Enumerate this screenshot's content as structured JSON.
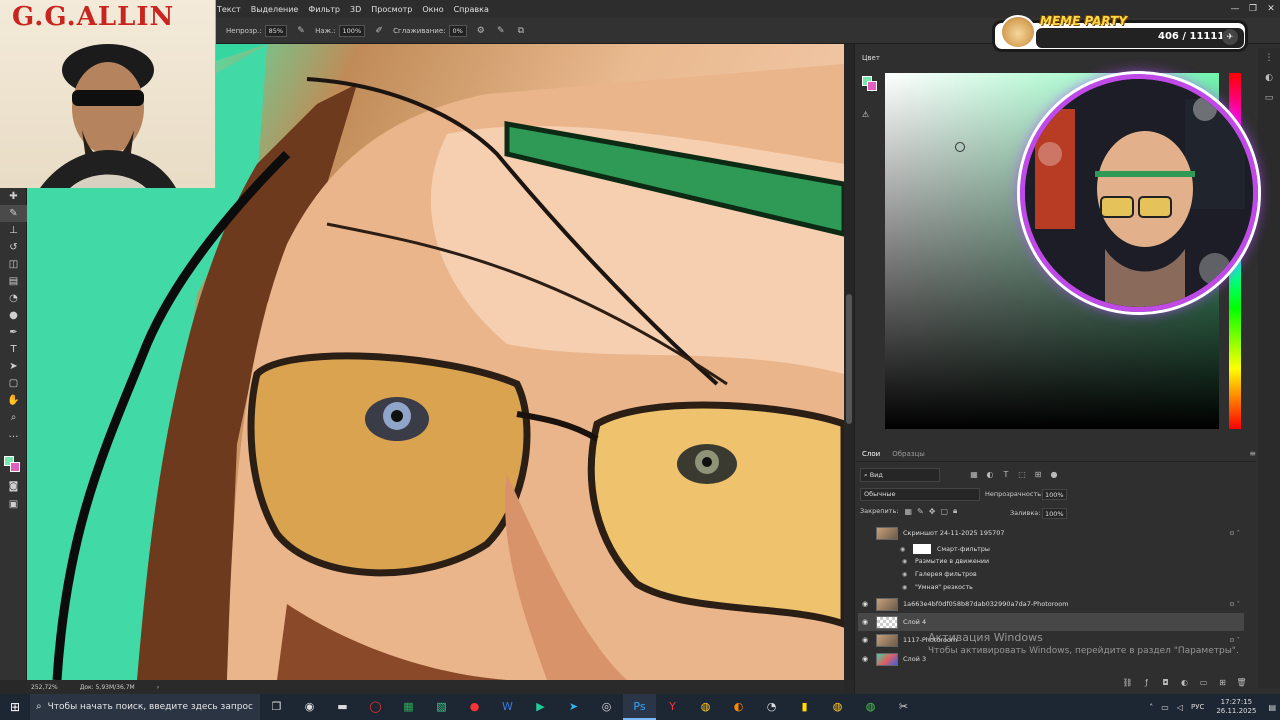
{
  "menu": {
    "items": [
      "Текст",
      "Выделение",
      "Фильтр",
      "3D",
      "Просмотр",
      "Окно",
      "Справка"
    ],
    "window_controls": [
      "—",
      "❐",
      "✕"
    ]
  },
  "options": {
    "opacity_label": "Непрозр.:",
    "opacity_value": "85%",
    "pressure_label": "Наж.:",
    "pressure_value": "100%",
    "smoothing_label": "Сглаживание:",
    "smoothing_value": "0%"
  },
  "overlay_photo": {
    "title": "G.G.ALLIN"
  },
  "status": {
    "zoom": "252,72%",
    "doc": "Док: 5,93M/36,7M",
    "arrow": "›"
  },
  "color_panel": {
    "title": "Цвет"
  },
  "layers_panel": {
    "tabs": [
      "Слои",
      "Образцы"
    ],
    "filter_label": "Вид",
    "blend_mode": "Обычные",
    "opacity_label": "Непрозрачность:",
    "opacity_value": "100%",
    "lock_label": "Закрепить:",
    "fill_label": "Заливка:",
    "fill_value": "100%",
    "layers": [
      {
        "name": "Скриншот 24-11-2025 195707"
      },
      {
        "name": "1a663e4bf0df058b87dab032990a7da7-Photoroom"
      },
      {
        "name": "Слой 4"
      },
      {
        "name": "1117-Photoroom"
      },
      {
        "name": "Слой 3"
      }
    ],
    "smart_filters": {
      "label": "Смарт-фильтры",
      "items": [
        "Размытие в движении",
        "Галерея фильтров",
        "\"Умная\" резкость"
      ]
    }
  },
  "activation": {
    "title": "Активация Windows",
    "subtitle": "Чтобы активировать Windows, перейдите в раздел \"Параметры\"."
  },
  "meme_party": {
    "title": "MEME PARTY",
    "counter": "406 / 111111"
  },
  "taskbar": {
    "search_placeholder": "Чтобы начать поиск, введите здесь запрос",
    "lang": "РУС",
    "time": "17:27:15",
    "date": "26.11.2025"
  },
  "colors": {
    "accent": "#77e7ac",
    "background_swatch": "#e05fc0",
    "webcam_ring": "#c04ae8"
  }
}
